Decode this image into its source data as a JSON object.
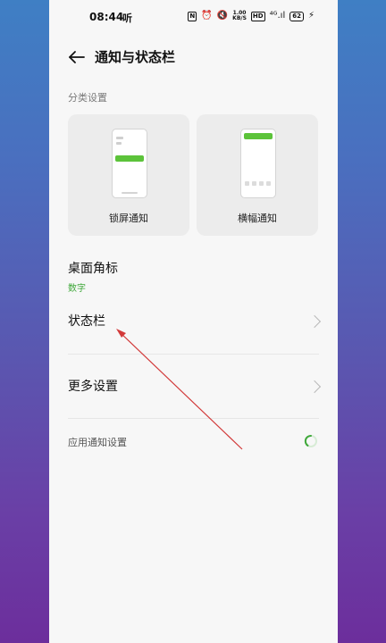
{
  "status_bar": {
    "time": "08:44",
    "extra": "听",
    "icons": [
      "nfc-icon",
      "alarm-icon",
      "mute-icon",
      "net-speed",
      "hd-icon",
      "signal-icon",
      "battery-icon",
      "charging-icon"
    ],
    "nfc": "N",
    "speed_value": "1.00",
    "speed_unit": "KB/S",
    "hd": "HD",
    "signal": "⁴ᴳ.ıl",
    "battery": "62"
  },
  "header": {
    "title": "通知与状态栏"
  },
  "classification": {
    "section_label": "分类设置",
    "cards": [
      {
        "label": "锁屏通知"
      },
      {
        "label": "横幅通知"
      }
    ]
  },
  "settings": {
    "desktop_badge": {
      "title": "桌面角标",
      "value": "数字"
    },
    "status_bar_item": {
      "title": "状态栏"
    },
    "more_settings": {
      "title": "更多设置"
    },
    "app_notifications": {
      "title": "应用通知设置"
    }
  },
  "colors": {
    "accent_green": "#3fa83a",
    "notification_bar": "#5cc33a"
  }
}
